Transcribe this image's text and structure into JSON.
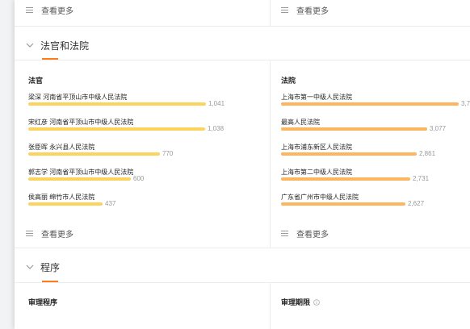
{
  "see_more": "查看更多",
  "section_judges_courts": {
    "title": "法官和法院"
  },
  "judges": {
    "title": "法官",
    "items": [
      {
        "name": "梁深",
        "court": "河南省平顶山市中级人民法院",
        "count": "1,041",
        "value": 1041
      },
      {
        "name": "宋红彦",
        "court": "河南省平顶山市中级人民法院",
        "count": "1,038",
        "value": 1038
      },
      {
        "name": "张臣晖",
        "court": "永兴县人民法院",
        "count": "770",
        "value": 770
      },
      {
        "name": "郭志学",
        "court": "河南省平顶山市中级人民法院",
        "count": "600",
        "value": 600
      },
      {
        "name": "侯高丽",
        "court": "绵竹市人民法院",
        "count": "437",
        "value": 437
      }
    ]
  },
  "courts": {
    "title": "法院",
    "items": [
      {
        "name": "上海市第一中级人民法院",
        "count": "3,7",
        "value": 3750
      },
      {
        "name": "最高人民法院",
        "count": "3,077",
        "value": 3077
      },
      {
        "name": "上海市浦东新区人民法院",
        "count": "2,861",
        "value": 2861
      },
      {
        "name": "上海市第二中级人民法院",
        "count": "2,731",
        "value": 2731
      },
      {
        "name": "广东省广州市中级人民法院",
        "count": "2,627",
        "value": 2627
      }
    ]
  },
  "section_procedure": {
    "title": "程序"
  },
  "procedure": {
    "left_title": "审理程序",
    "right_title": "审理期限"
  },
  "colors": {
    "accent": "#ff7a1a",
    "judge_bar": "#fcd35f",
    "court_bar": "#fdb55f"
  }
}
